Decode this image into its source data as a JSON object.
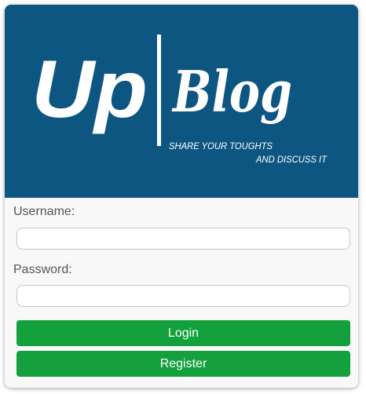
{
  "logo": {
    "up_text": "Up",
    "blog_text": "Blog",
    "tagline_line1": "SHARE YOUR TOUGHTS",
    "tagline_line2": "AND DISCUSS IT"
  },
  "form": {
    "username_label": "Username:",
    "username_value": "",
    "password_label": "Password:",
    "password_value": "",
    "login_label": "Login",
    "register_label": "Register"
  },
  "colors": {
    "banner": "#0e5682",
    "button": "#13a03d",
    "card_bg": "#f8f8f8"
  }
}
